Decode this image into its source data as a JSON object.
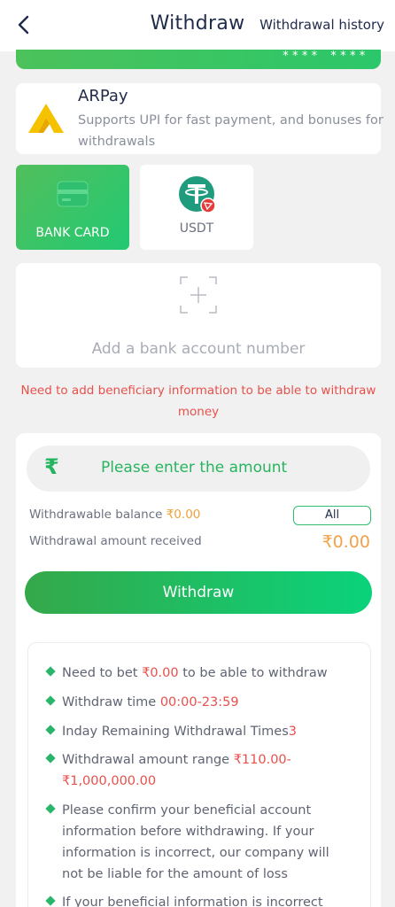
{
  "header": {
    "title": "Withdraw",
    "history_label": "Withdrawal history"
  },
  "card": {
    "masked": "**** ****"
  },
  "arpay": {
    "name": "ARPay",
    "description": "Supports UPI for fast payment, and bonuses for withdrawals"
  },
  "methods": [
    {
      "label": "BANK CARD",
      "active": true,
      "icon": "bank-card-icon"
    },
    {
      "label": "USDT",
      "active": false,
      "icon": "usdt-icon"
    }
  ],
  "add_bank": {
    "label": "Add a bank account number"
  },
  "warning": "Need to add beneficiary information to be able to withdraw money",
  "amount": {
    "currency_symbol": "₹",
    "placeholder": "Please enter the amount",
    "balance_label": "Withdrawable balance ",
    "balance_value": "₹0.00",
    "all_label": "All",
    "received_label": "Withdrawal amount received",
    "received_value": "₹0.00",
    "withdraw_label": "Withdraw"
  },
  "rules": [
    {
      "text": "Need to bet ",
      "highlight": "₹0.00",
      "suffix": " to be able to withdraw"
    },
    {
      "text": "Withdraw time ",
      "highlight": "00:00-23:59",
      "suffix": ""
    },
    {
      "text": "Inday Remaining Withdrawal Times",
      "highlight": "3",
      "suffix": ""
    },
    {
      "text": "Withdrawal amount range ",
      "highlight": "₹110.00-₹1,000,000.00",
      "suffix": ""
    },
    {
      "text": "Please confirm your beneficial account information before withdrawing. If your information is incorrect, our company will not be liable for the amount of loss",
      "highlight": "",
      "suffix": ""
    },
    {
      "text": "If your beneficial information is incorrect",
      "highlight": "",
      "suffix": ""
    }
  ],
  "colors": {
    "accent": "#22c973",
    "warning": "#e8504b",
    "money": "#f3a14a"
  }
}
